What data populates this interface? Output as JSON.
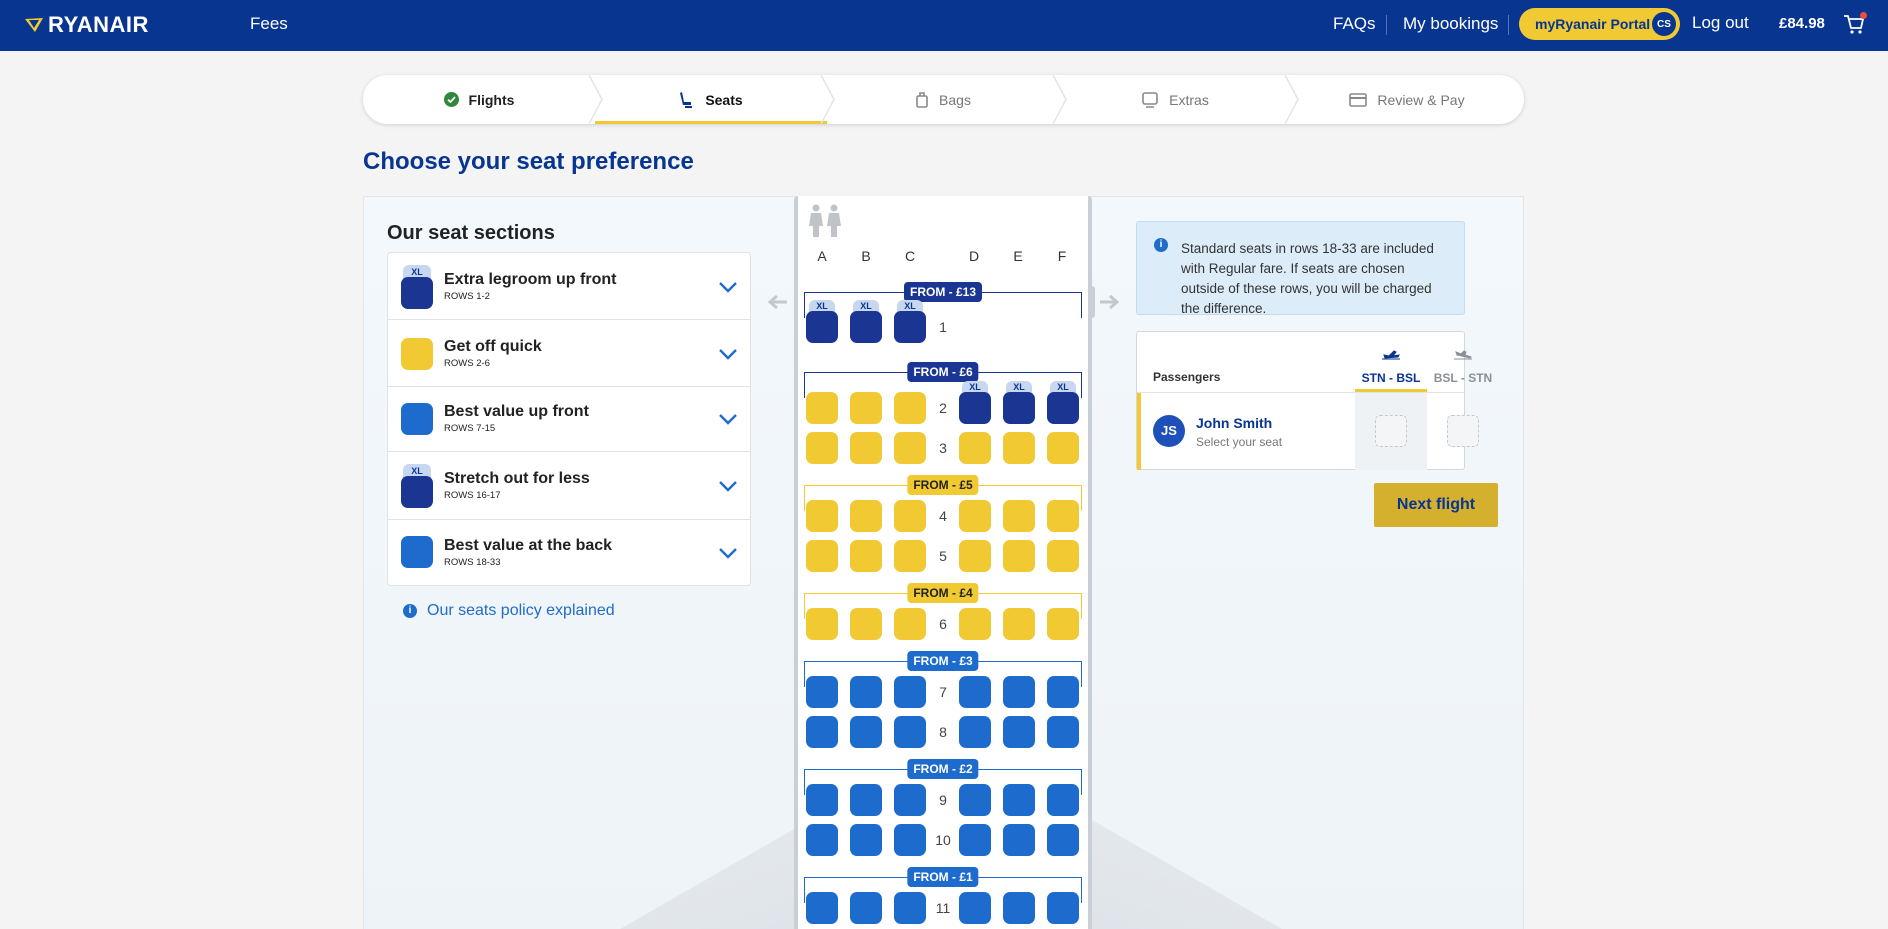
{
  "header": {
    "logo": "RYANAIR",
    "fees": "Fees",
    "faqs": "FAQs",
    "my_bookings": "My bookings",
    "portal": "myRyanair Portal",
    "portal_initials": "CS",
    "logout": "Log out",
    "basket_total": "£84.98"
  },
  "steps": [
    {
      "label": "Flights",
      "state": "done"
    },
    {
      "label": "Seats",
      "state": "active"
    },
    {
      "label": "Bags",
      "state": "pending"
    },
    {
      "label": "Extras",
      "state": "pending"
    },
    {
      "label": "Review & Pay",
      "state": "pending"
    }
  ],
  "page_title": "Choose your seat preference",
  "sections": {
    "title": "Our seat sections",
    "items": [
      {
        "name": "Extra legroom up front",
        "rows": "ROWS 1-2",
        "xl": "XL",
        "color": "#1a3592"
      },
      {
        "name": "Get off quick",
        "rows": "ROWS 2-6",
        "color": "#f1c933"
      },
      {
        "name": "Best value up front",
        "rows": "ROWS 7-15",
        "color": "#1d6bcc"
      },
      {
        "name": "Stretch out for less",
        "rows": "ROWS 16-17",
        "xl": "XL",
        "color": "#1a3592"
      },
      {
        "name": "Best value at the back",
        "rows": "ROWS 18-33",
        "color": "#1d6bcc"
      }
    ],
    "policy_link": "Our seats policy explained"
  },
  "seatmap": {
    "columns": [
      "A",
      "B",
      "C",
      "D",
      "E",
      "F"
    ],
    "xl_tag": "XL",
    "price_labels": [
      "FROM - £13",
      "FROM - £6",
      "FROM - £5",
      "FROM - £4",
      "FROM - £3",
      "FROM - £2",
      "FROM - £1"
    ],
    "row_numbers": [
      "1",
      "2",
      "3",
      "4",
      "5",
      "6",
      "7",
      "8",
      "9",
      "10",
      "11"
    ],
    "colors": {
      "xl": "#1a3592",
      "yellow": "#f1c933",
      "blue": "#1d6bcc"
    }
  },
  "info": {
    "text": "Standard seats in rows 18-33 are included with Regular fare. If seats are chosen outside of these rows, you will be charged the difference."
  },
  "passengers": {
    "header": "Passengers",
    "flights": [
      "STN - BSL",
      "BSL - STN"
    ],
    "name": "John Smith",
    "initials": "JS",
    "prompt": "Select your seat"
  },
  "next_button": "Next flight"
}
